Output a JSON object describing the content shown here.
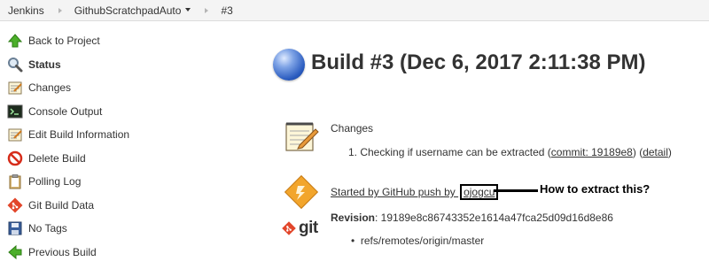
{
  "breadcrumb": {
    "items": [
      "Jenkins",
      "GithubScratchpadAuto",
      "#3"
    ]
  },
  "sidebar": {
    "items": [
      {
        "label": "Back to Project",
        "icon": "up-arrow-icon"
      },
      {
        "label": "Status",
        "icon": "magnifier-icon",
        "active": true
      },
      {
        "label": "Changes",
        "icon": "notepad-icon"
      },
      {
        "label": "Console Output",
        "icon": "terminal-icon"
      },
      {
        "label": "Edit Build Information",
        "icon": "notepad-edit-icon"
      },
      {
        "label": "Delete Build",
        "icon": "no-entry-icon"
      },
      {
        "label": "Polling Log",
        "icon": "clipboard-icon"
      },
      {
        "label": "Git Build Data",
        "icon": "git-icon"
      },
      {
        "label": "No Tags",
        "icon": "save-icon"
      },
      {
        "label": "Previous Build",
        "icon": "left-arrow-icon"
      }
    ]
  },
  "main": {
    "title": "Build #3 (Dec 6, 2017 2:11:38 PM)",
    "status_color": "#2a5bbf",
    "changes": {
      "heading": "Changes",
      "item_prefix": "1. Checking if username can be extracted (",
      "commit_link": "commit: 19189e8",
      "mid": ") (",
      "detail_link": "detail",
      "suffix": ")"
    },
    "cause": {
      "prefix": "Started by GitHub push by ",
      "user": "ojogcu"
    },
    "annotation": "How to extract this?",
    "git": {
      "logo_text": "git",
      "revision_label": "Revision",
      "revision_value": ": 19189e8c86743352e1614a47fca25d09d16d8e86",
      "refs": [
        "refs/remotes/origin/master"
      ]
    }
  }
}
